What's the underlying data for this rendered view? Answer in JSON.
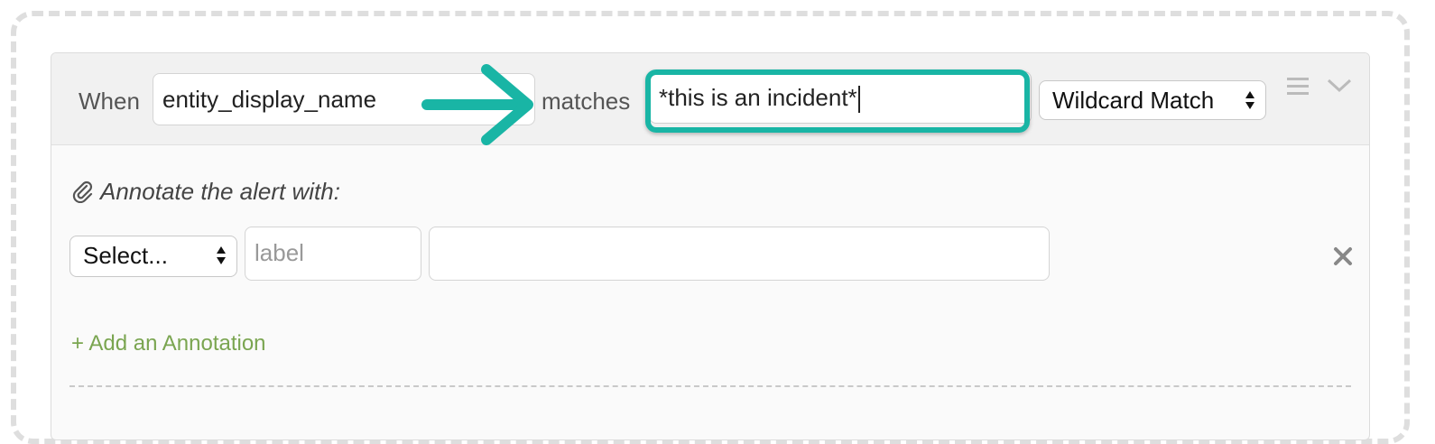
{
  "condition": {
    "when_label": "When",
    "field_value": "entity_display_name",
    "operator_label": "matches",
    "pattern_value": "*this is an incident*",
    "match_type": "Wildcard Match"
  },
  "annotations": {
    "title": "Annotate the alert with:",
    "row": {
      "select_value": "Select...",
      "label_placeholder": "label",
      "value": ""
    },
    "add_link": "+ Add an Annotation"
  },
  "colors": {
    "highlight": "#19b5a5",
    "add_link": "#7aa550"
  },
  "icons": [
    "menu-icon",
    "chevron-down-icon",
    "paperclip-icon",
    "close-icon",
    "arrow-right-icon"
  ]
}
